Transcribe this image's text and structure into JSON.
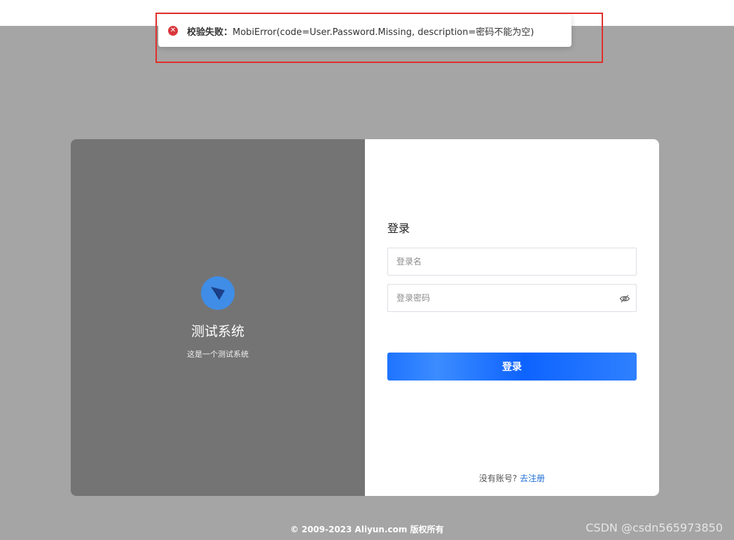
{
  "toast": {
    "icon": "error-circle-icon",
    "title": "校验失败：",
    "message": "MobiError(code=User.Password.Missing, description=密码不能为空)",
    "color": "#d9363e"
  },
  "brand": {
    "logo_icon": "paper-plane-logo-icon",
    "title": "测试系统",
    "subtitle": "这是一个测试系统"
  },
  "login": {
    "heading": "登录",
    "username_placeholder": "登录名",
    "username_value": "",
    "password_placeholder": "登录密码",
    "password_value": "",
    "password_toggle_icon": "eye-slash-icon",
    "submit_label": "登录",
    "no_account_text": "没有账号?",
    "register_link": "去注册"
  },
  "footer": {
    "copyright": "© 2009-2023 Aliyun.com 版权所有"
  },
  "watermark": "CSDN @csdn565973850",
  "colors": {
    "accent": "#1e74ff",
    "overlay": "#a5a5a5",
    "brand_panel": "#747474",
    "highlight": "#e0302a"
  }
}
